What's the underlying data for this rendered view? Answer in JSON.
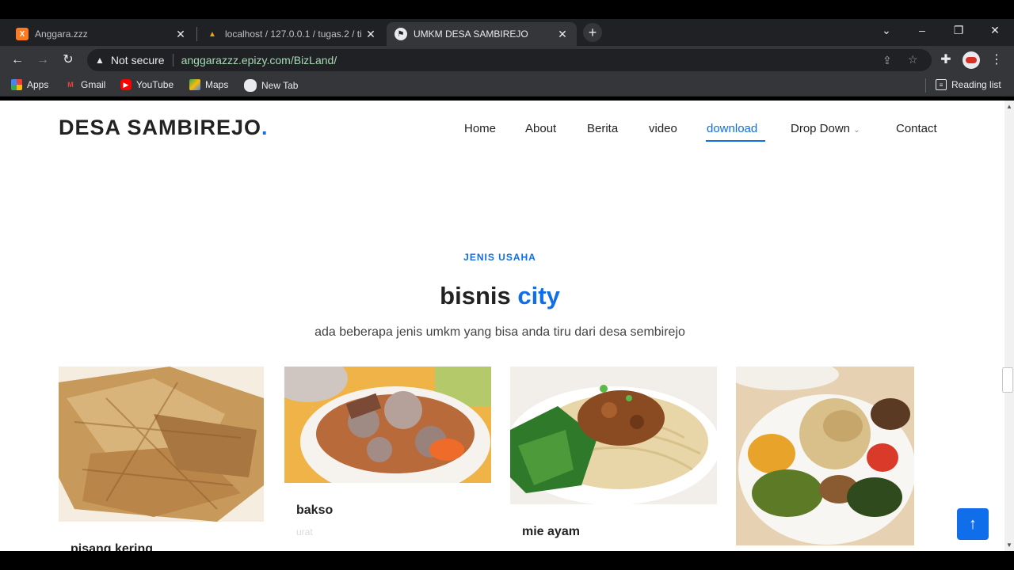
{
  "browser": {
    "tabs": [
      {
        "label": "Anggara.zzz",
        "favicon": "xampp-icon",
        "active": false
      },
      {
        "label": "localhost / 127.0.0.1 / tugas.2 / ti",
        "favicon": "phpmyadmin-icon",
        "active": false
      },
      {
        "label": "UMKM DESA SAMBIREJO",
        "favicon": "site-icon",
        "active": true
      }
    ],
    "security_label": "Not secure",
    "url": "anggarazzz.epizy.com/BizLand/",
    "bookmarks": [
      {
        "label": "Apps",
        "icon": "apps-grid-icon"
      },
      {
        "label": "Gmail",
        "icon": "gmail-icon"
      },
      {
        "label": "YouTube",
        "icon": "youtube-icon"
      },
      {
        "label": "Maps",
        "icon": "maps-icon"
      },
      {
        "label": "New Tab",
        "icon": "globe-icon"
      }
    ],
    "reading_list": "Reading list"
  },
  "site": {
    "logo_text": "DESA SAMBIREJO",
    "logo_dot": ".",
    "nav": [
      {
        "label": "Home",
        "active": false
      },
      {
        "label": "About",
        "active": false
      },
      {
        "label": "Berita",
        "active": false
      },
      {
        "label": "video",
        "active": false
      },
      {
        "label": "download",
        "active": true
      },
      {
        "label": "Drop Down",
        "active": false,
        "dropdown": true
      },
      {
        "label": "Contact",
        "active": false
      }
    ],
    "section": {
      "eyebrow": "JENIS USAHA",
      "title_plain": "bisnis",
      "title_accent": "city",
      "subtitle": "ada beberapa jenis umkm yang bisa anda tiru dari desa sembirejo"
    },
    "cards": [
      {
        "name": "pisang kering",
        "desc": "",
        "image": "pisang-kering-photo"
      },
      {
        "name": "bakso",
        "desc": "urat",
        "image": "bakso-photo"
      },
      {
        "name": "mie ayam",
        "desc": "",
        "image": "mie-ayam-photo"
      },
      {
        "name": "",
        "desc": "",
        "image": "nasi-campur-photo"
      }
    ]
  },
  "colors": {
    "accent": "#106eea",
    "text_dark": "#222222",
    "browser_dark": "#202124",
    "browser_toolbar": "#35363a"
  }
}
